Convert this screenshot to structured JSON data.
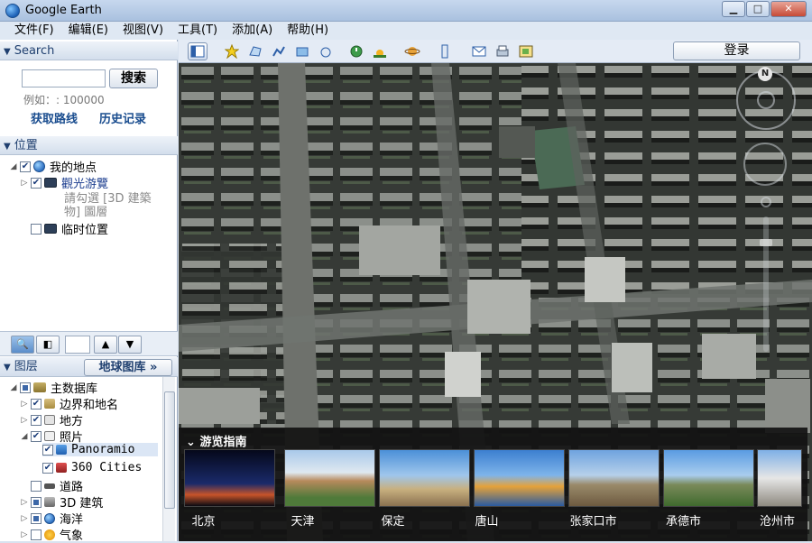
{
  "window": {
    "title": "Google Earth"
  },
  "menu": [
    "文件(F)",
    "编辑(E)",
    "视图(V)",
    "工具(T)",
    "添加(A)",
    "帮助(H)"
  ],
  "search": {
    "header": "Search",
    "button": "搜索",
    "example": "例如：: 100000",
    "links": [
      "获取路线",
      "历史记录"
    ]
  },
  "places": {
    "header": "位置",
    "items": [
      {
        "label": "我的地点"
      },
      {
        "label": "觀光游覽"
      },
      {
        "label": "請勾選 [3D 建築"
      },
      {
        "label": "物] 圖層"
      },
      {
        "label": "临时位置"
      }
    ]
  },
  "layers": {
    "header": "图层",
    "gallery_button": "地球图库 »",
    "items": [
      {
        "label": "主数据库"
      },
      {
        "label": "边界和地名"
      },
      {
        "label": "地方"
      },
      {
        "label": "照片"
      },
      {
        "label": "Panoramio"
      },
      {
        "label": "360 Cities"
      },
      {
        "label": "道路"
      },
      {
        "label": "3D 建筑"
      },
      {
        "label": "海洋"
      },
      {
        "label": "气象"
      }
    ]
  },
  "toolbar": {
    "login": "登录"
  },
  "compass": {
    "north": "N"
  },
  "tour": {
    "header": "游览指南",
    "cities": [
      "北京",
      "天津",
      "保定",
      "唐山",
      "张家口市",
      "承德市",
      "沧州市"
    ]
  },
  "colors": {
    "map_base": "#3c403c",
    "title_bar": "#b8cce6",
    "section_header_text": "#1f3f6f",
    "link": "#1a4d8f"
  }
}
